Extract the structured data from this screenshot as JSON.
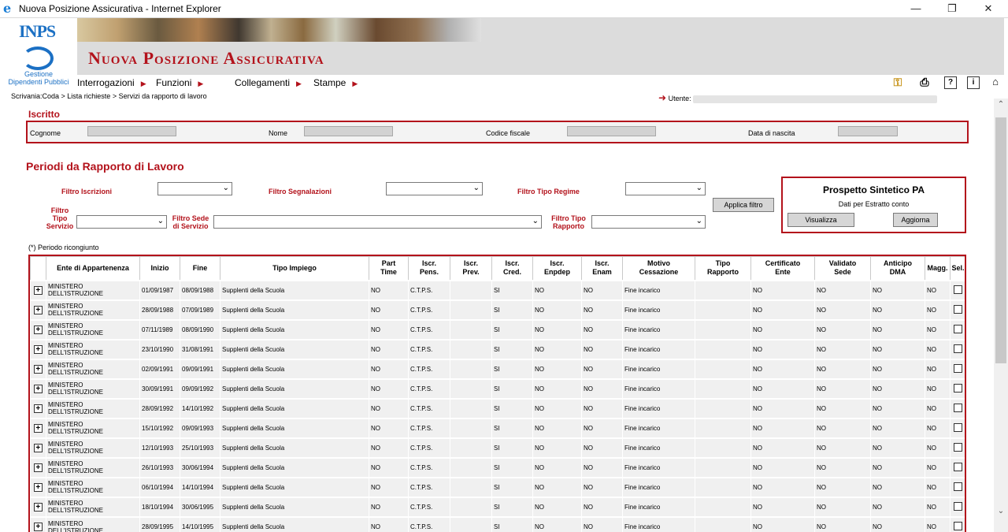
{
  "window": {
    "title": "Nuova Posizione Assicurativa - Internet Explorer"
  },
  "logo": {
    "text": "INPS",
    "sub1": "Gestione",
    "sub2": "Dipendenti Pubblici"
  },
  "app": {
    "title": "Nuova Posizione Assicurativa"
  },
  "menu": [
    "Interrogazioni",
    "Funzioni",
    "Collegamenti",
    "Stampe"
  ],
  "breadcrumb": "Scrivania:Coda > Lista richieste > Servizi da rapporto di lavoro",
  "utente_label": "Utente:",
  "iscritto": {
    "title": "Iscritto",
    "cognome": "Cognome",
    "nome": "Nome",
    "codice_fiscale": "Codice fiscale",
    "data_nascita": "Data di nascita"
  },
  "periodi": {
    "title": "Periodi da Rapporto di Lavoro"
  },
  "filters": {
    "iscrizioni": "Filtro Iscrizioni",
    "segnalazioni": "Filtro Segnalazioni",
    "tipo_regime": "Filtro Tipo Regime",
    "tipo_servizio_1": "Filtro",
    "tipo_servizio_2": "Tipo",
    "tipo_servizio_3": "Servizio",
    "sede_1": "Filtro Sede",
    "sede_2": "di Servizio",
    "tipo_rapporto_1": "Filtro Tipo",
    "tipo_rapporto_2": "Rapporto",
    "apply": "Applica filtro"
  },
  "prospetto": {
    "title": "Prospetto Sintetico PA",
    "subtitle": "Dati per Estratto conto",
    "visualizza": "Visualizza",
    "aggiorna": "Aggiorna"
  },
  "note": "(*) Periodo ricongiunto",
  "columns": [
    {
      "l1": "",
      "l2": ""
    },
    {
      "l1": "Ente di Appartenenza",
      "l2": ""
    },
    {
      "l1": "Inizio",
      "l2": ""
    },
    {
      "l1": "Fine",
      "l2": ""
    },
    {
      "l1": "Tipo Impiego",
      "l2": ""
    },
    {
      "l1": "Part",
      "l2": "Time"
    },
    {
      "l1": "Iscr.",
      "l2": "Pens."
    },
    {
      "l1": "Iscr.",
      "l2": "Prev."
    },
    {
      "l1": "Iscr.",
      "l2": "Cred."
    },
    {
      "l1": "Iscr.",
      "l2": "Enpdep"
    },
    {
      "l1": "Iscr.",
      "l2": "Enam"
    },
    {
      "l1": "Motivo",
      "l2": "Cessazione"
    },
    {
      "l1": "Tipo",
      "l2": "Rapporto"
    },
    {
      "l1": "Certificato",
      "l2": "Ente"
    },
    {
      "l1": "Validato",
      "l2": "Sede"
    },
    {
      "l1": "Anticipo",
      "l2": "DMA"
    },
    {
      "l1": "Magg.",
      "l2": ""
    },
    {
      "l1": "Sel.",
      "l2": ""
    }
  ],
  "rows": [
    {
      "ente1": "MINISTERO",
      "ente2": "DELL'ISTRUZIONE",
      "inizio": "01/09/1987",
      "fine": "08/09/1988",
      "tipo": "Supplenti della Scuola",
      "part": "NO",
      "pens": "C.T.P.S.",
      "prev": "",
      "cred": "SI",
      "enpdep": "NO",
      "enam": "NO",
      "motivo": "Fine incarico",
      "rapporto": "",
      "cert": "NO",
      "valid": "NO",
      "antic": "NO",
      "magg": "NO"
    },
    {
      "ente1": "MINISTERO",
      "ente2": "DELL'ISTRUZIONE",
      "inizio": "28/09/1988",
      "fine": "07/09/1989",
      "tipo": "Supplenti della Scuola",
      "part": "NO",
      "pens": "C.T.P.S.",
      "prev": "",
      "cred": "SI",
      "enpdep": "NO",
      "enam": "NO",
      "motivo": "Fine incarico",
      "rapporto": "",
      "cert": "NO",
      "valid": "NO",
      "antic": "NO",
      "magg": "NO"
    },
    {
      "ente1": "MINISTERO",
      "ente2": "DELL'ISTRUZIONE",
      "inizio": "07/11/1989",
      "fine": "08/09/1990",
      "tipo": "Supplenti della Scuola",
      "part": "NO",
      "pens": "C.T.P.S.",
      "prev": "",
      "cred": "SI",
      "enpdep": "NO",
      "enam": "NO",
      "motivo": "Fine incarico",
      "rapporto": "",
      "cert": "NO",
      "valid": "NO",
      "antic": "NO",
      "magg": "NO"
    },
    {
      "ente1": "MINISTERO",
      "ente2": "DELL'ISTRUZIONE",
      "inizio": "23/10/1990",
      "fine": "31/08/1991",
      "tipo": "Supplenti della Scuola",
      "part": "NO",
      "pens": "C.T.P.S.",
      "prev": "",
      "cred": "SI",
      "enpdep": "NO",
      "enam": "NO",
      "motivo": "Fine incarico",
      "rapporto": "",
      "cert": "NO",
      "valid": "NO",
      "antic": "NO",
      "magg": "NO"
    },
    {
      "ente1": "MINISTERO",
      "ente2": "DELL'ISTRUZIONE",
      "inizio": "02/09/1991",
      "fine": "09/09/1991",
      "tipo": "Supplenti della Scuola",
      "part": "NO",
      "pens": "C.T.P.S.",
      "prev": "",
      "cred": "SI",
      "enpdep": "NO",
      "enam": "NO",
      "motivo": "Fine incarico",
      "rapporto": "",
      "cert": "NO",
      "valid": "NO",
      "antic": "NO",
      "magg": "NO"
    },
    {
      "ente1": "MINISTERO",
      "ente2": "DELL'ISTRUZIONE",
      "inizio": "30/09/1991",
      "fine": "09/09/1992",
      "tipo": "Supplenti della Scuola",
      "part": "NO",
      "pens": "C.T.P.S.",
      "prev": "",
      "cred": "SI",
      "enpdep": "NO",
      "enam": "NO",
      "motivo": "Fine incarico",
      "rapporto": "",
      "cert": "NO",
      "valid": "NO",
      "antic": "NO",
      "magg": "NO"
    },
    {
      "ente1": "MINISTERO",
      "ente2": "DELL'ISTRUZIONE",
      "inizio": "28/09/1992",
      "fine": "14/10/1992",
      "tipo": "Supplenti della Scuola",
      "part": "NO",
      "pens": "C.T.P.S.",
      "prev": "",
      "cred": "SI",
      "enpdep": "NO",
      "enam": "NO",
      "motivo": "Fine incarico",
      "rapporto": "",
      "cert": "NO",
      "valid": "NO",
      "antic": "NO",
      "magg": "NO"
    },
    {
      "ente1": "MINISTERO",
      "ente2": "DELL'ISTRUZIONE",
      "inizio": "15/10/1992",
      "fine": "09/09/1993",
      "tipo": "Supplenti della Scuola",
      "part": "NO",
      "pens": "C.T.P.S.",
      "prev": "",
      "cred": "SI",
      "enpdep": "NO",
      "enam": "NO",
      "motivo": "Fine incarico",
      "rapporto": "",
      "cert": "NO",
      "valid": "NO",
      "antic": "NO",
      "magg": "NO"
    },
    {
      "ente1": "MINISTERO",
      "ente2": "DELL'ISTRUZIONE",
      "inizio": "12/10/1993",
      "fine": "25/10/1993",
      "tipo": "Supplenti della Scuola",
      "part": "NO",
      "pens": "C.T.P.S.",
      "prev": "",
      "cred": "SI",
      "enpdep": "NO",
      "enam": "NO",
      "motivo": "Fine incarico",
      "rapporto": "",
      "cert": "NO",
      "valid": "NO",
      "antic": "NO",
      "magg": "NO"
    },
    {
      "ente1": "MINISTERO",
      "ente2": "DELL'ISTRUZIONE",
      "inizio": "26/10/1993",
      "fine": "30/06/1994",
      "tipo": "Supplenti della Scuola",
      "part": "NO",
      "pens": "C.T.P.S.",
      "prev": "",
      "cred": "SI",
      "enpdep": "NO",
      "enam": "NO",
      "motivo": "Fine incarico",
      "rapporto": "",
      "cert": "NO",
      "valid": "NO",
      "antic": "NO",
      "magg": "NO"
    },
    {
      "ente1": "MINISTERO",
      "ente2": "DELL'ISTRUZIONE",
      "inizio": "06/10/1994",
      "fine": "14/10/1994",
      "tipo": "Supplenti della Scuola",
      "part": "NO",
      "pens": "C.T.P.S.",
      "prev": "",
      "cred": "SI",
      "enpdep": "NO",
      "enam": "NO",
      "motivo": "Fine incarico",
      "rapporto": "",
      "cert": "NO",
      "valid": "NO",
      "antic": "NO",
      "magg": "NO"
    },
    {
      "ente1": "MINISTERO",
      "ente2": "DELL'ISTRUZIONE",
      "inizio": "18/10/1994",
      "fine": "30/06/1995",
      "tipo": "Supplenti della Scuola",
      "part": "NO",
      "pens": "C.T.P.S.",
      "prev": "",
      "cred": "SI",
      "enpdep": "NO",
      "enam": "NO",
      "motivo": "Fine incarico",
      "rapporto": "",
      "cert": "NO",
      "valid": "NO",
      "antic": "NO",
      "magg": "NO"
    },
    {
      "ente1": "MINISTERO",
      "ente2": "DELL'ISTRUZIONE",
      "inizio": "28/09/1995",
      "fine": "14/10/1995",
      "tipo": "Supplenti della Scuola",
      "part": "NO",
      "pens": "C.T.P.S.",
      "prev": "",
      "cred": "SI",
      "enpdep": "NO",
      "enam": "NO",
      "motivo": "Fine incarico",
      "rapporto": "",
      "cert": "NO",
      "valid": "NO",
      "antic": "NO",
      "magg": "NO"
    }
  ]
}
